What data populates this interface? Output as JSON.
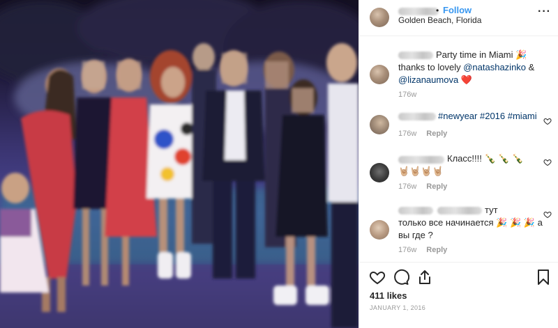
{
  "header": {
    "follow_separator": "•",
    "follow_label": "Follow",
    "location": "Golden Beach, Florida",
    "more_label": "···"
  },
  "caption": {
    "line1": "Party time in Miami 🎉",
    "line2_prefix": "thanks to lovely ",
    "mention1": "@natashazinko",
    "line2_suffix": " &",
    "mention2": "@lizanaumova",
    "line3_suffix": " ❤️",
    "time": "176w"
  },
  "comments": [
    {
      "text": "#newyear #2016 #miami",
      "time": "176w",
      "reply": "Reply"
    },
    {
      "line1": "Класс!!!! 🍾 🍾 🍾",
      "line2": "🤘🏼🤘🏼🤘🏼🤘🏼",
      "time": "176w",
      "reply": "Reply"
    },
    {
      "line1_suffix": "тут",
      "line2": "только все начинается 🎉 🎉 🎉  а",
      "line3": "вы где ?",
      "time": "176w",
      "reply": "Reply"
    }
  ],
  "footer": {
    "likes": "411 likes",
    "date": "JANUARY 1, 2016"
  },
  "icons": [
    "heart-icon",
    "comment-icon",
    "share-icon",
    "bookmark-icon",
    "more-icon"
  ],
  "colors": {
    "link": "#003569",
    "follow": "#3897f0",
    "muted": "#999999",
    "border": "#efefef"
  }
}
